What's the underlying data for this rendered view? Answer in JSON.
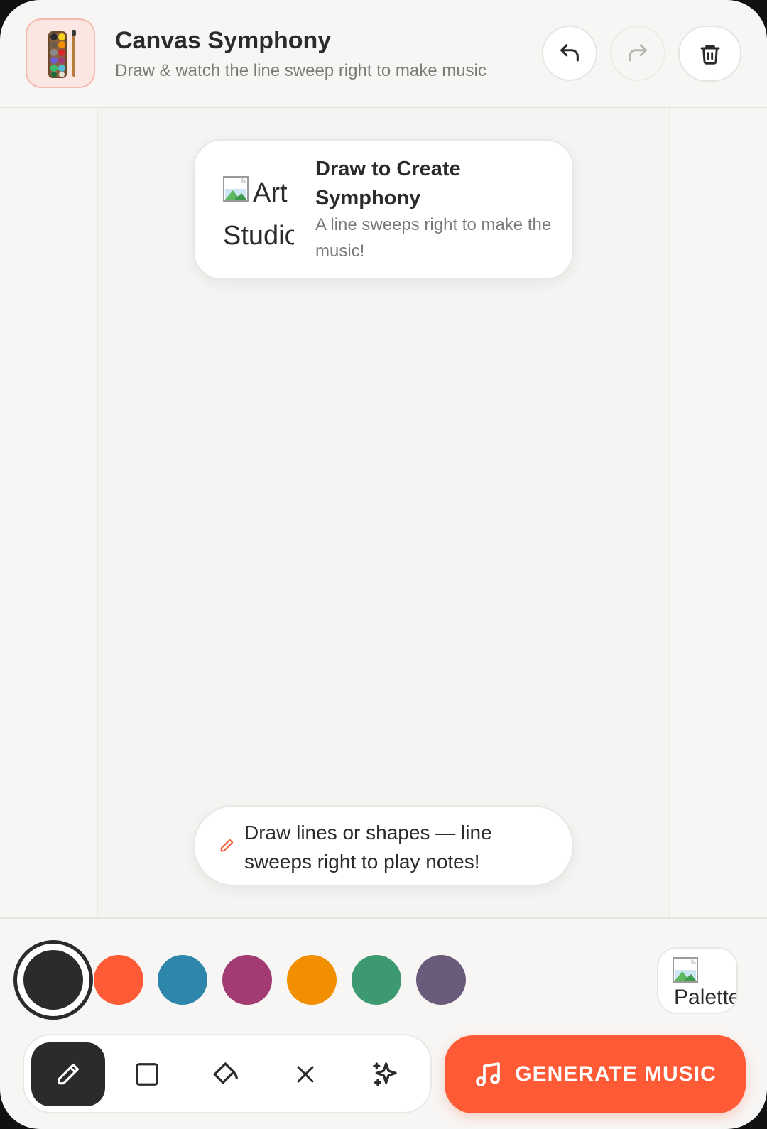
{
  "header": {
    "title": "Canvas Symphony",
    "subtitle": "Draw & watch the line sweep right to make music",
    "app_icon": "palette-app-icon",
    "buttons": {
      "undo": {
        "icon": "undo-icon",
        "enabled": true
      },
      "redo": {
        "icon": "redo-icon",
        "enabled": false
      },
      "clear": {
        "icon": "trash-icon",
        "enabled": true
      }
    }
  },
  "info_card": {
    "image_alt": "Art Studio",
    "title": "Draw to Create Symphony",
    "description": "A line sweeps right to make the music!"
  },
  "hint": {
    "icon": "pencil-icon",
    "text": "Draw lines or shapes — line sweeps right to play notes!"
  },
  "colors": {
    "selected": "#2b2b2e",
    "swatches": [
      "#2b2b2e",
      "#ff5a36",
      "#2e86ab",
      "#a23b72",
      "#f18f01",
      "#3d9970",
      "#6b5b7b"
    ]
  },
  "palette_button": {
    "image_alt": "Palette"
  },
  "tools": [
    {
      "name": "pen",
      "icon": "pencil-icon",
      "active": true
    },
    {
      "name": "rectangle",
      "icon": "square-icon",
      "active": false
    },
    {
      "name": "fill",
      "icon": "paint-bucket-icon",
      "active": false
    },
    {
      "name": "clear",
      "icon": "close-icon",
      "active": false
    },
    {
      "name": "sparkle",
      "icon": "sparkle-icon",
      "active": false
    }
  ],
  "generate_button": {
    "icon": "music-note-icon",
    "label": "GENERATE MUSIC",
    "color": "#ff5a36"
  }
}
